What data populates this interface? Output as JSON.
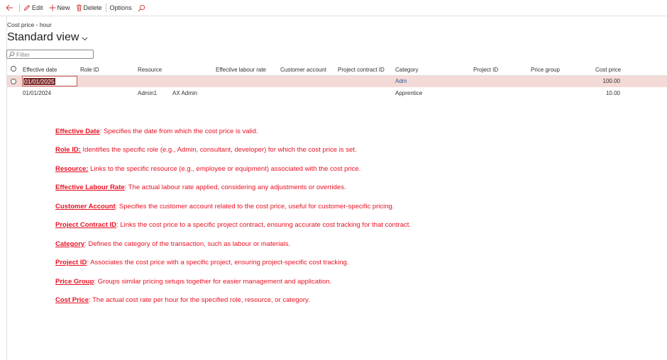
{
  "toolbar": {
    "edit_label": "Edit",
    "new_label": "New",
    "delete_label": "Delete",
    "options_label": "Options"
  },
  "page": {
    "caption": "Cost price - hour",
    "view_title": "Standard view"
  },
  "filter": {
    "placeholder": "Filter"
  },
  "columns": {
    "effective_date": "Effective date",
    "role_id": "Role ID",
    "resource": "Resource",
    "effective_labour_rate": "Effective labour rate",
    "customer_account": "Customer account",
    "project_contract_id": "Project contract ID",
    "category": "Category",
    "project_id": "Project ID",
    "price_group": "Price group",
    "cost_price": "Cost price"
  },
  "rows": [
    {
      "effective_date": "01/01/2025",
      "resource": "",
      "resource_name": "",
      "category": "Adm",
      "cost_price": "100.00"
    },
    {
      "effective_date": "01/01/2024",
      "resource": "Admin1",
      "resource_name": "AX Admin",
      "category": "Apprentice",
      "cost_price": "10.00"
    }
  ],
  "descriptions": [
    {
      "term": "Effective Date",
      "text": ": Specifies the date from which the cost price is valid."
    },
    {
      "term": "Role ID:",
      "text": " Identifies the specific role (e.g., Admin, consultant, developer) for which the cost price is set."
    },
    {
      "term": "Resource:",
      "text": " Links to the specific resource (e.g., employee or equipment) associated with the cost price."
    },
    {
      "term": "Effective Labour Rate",
      "text": ": The actual labour rate applied, considering any adjustments or overrides."
    },
    {
      "term": "Customer Account",
      "text": ": Specifies the customer account related to the cost price, useful for customer-specific pricing."
    },
    {
      "term": "Project Contract ID",
      "text": ": Links the cost price to a specific project contract, ensuring accurate cost tracking for that contract."
    },
    {
      "term": "Category",
      "text": ": Defines the category of the transaction, such as labour or materials."
    },
    {
      "term": "Project ID",
      "text": ": Associates the cost price with a specific project, ensuring project-specific cost tracking."
    },
    {
      "term": "Price Group",
      "text": ": Groups similar pricing setups together for easier management and application."
    },
    {
      "term": "Cost Price",
      "text": ": The actual cost rate per hour for the specified role, resource, or category."
    }
  ]
}
